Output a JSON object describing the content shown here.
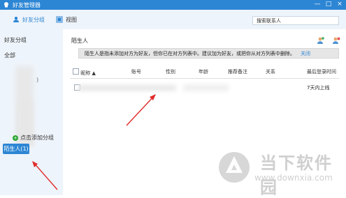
{
  "window": {
    "title": "好友管理器",
    "controls": {
      "minimize": "—",
      "maximize": "□",
      "close": "×"
    }
  },
  "toolbar": {
    "tab_friends_group": "好友分组",
    "tab_view": "视图",
    "search": {
      "value": "搜索联系人"
    }
  },
  "sidebar": {
    "header": "好友分组",
    "group_all": "全部",
    "paren": ")",
    "add_group": "点击添加分组",
    "stranger": "陌生人(1)"
  },
  "content": {
    "title": "陌生人",
    "notice": "陌生人是指未添加对方为好友，但你已在对方列表中。建议加为好友，或把你从对方列表中删除。",
    "notice_close": "关闭",
    "columns": [
      "昵称 ▲",
      "账号",
      "性别",
      "年龄",
      "推荐备注",
      "关系",
      "最后登录时间"
    ],
    "row": {
      "last_login": "7天内上线"
    }
  },
  "watermark": {
    "text": "当下软件园",
    "url": "www.downxia.com"
  },
  "colors": {
    "accent": "#2d86d4",
    "panel": "#eef4fb",
    "arrow": "#e02b2b"
  }
}
